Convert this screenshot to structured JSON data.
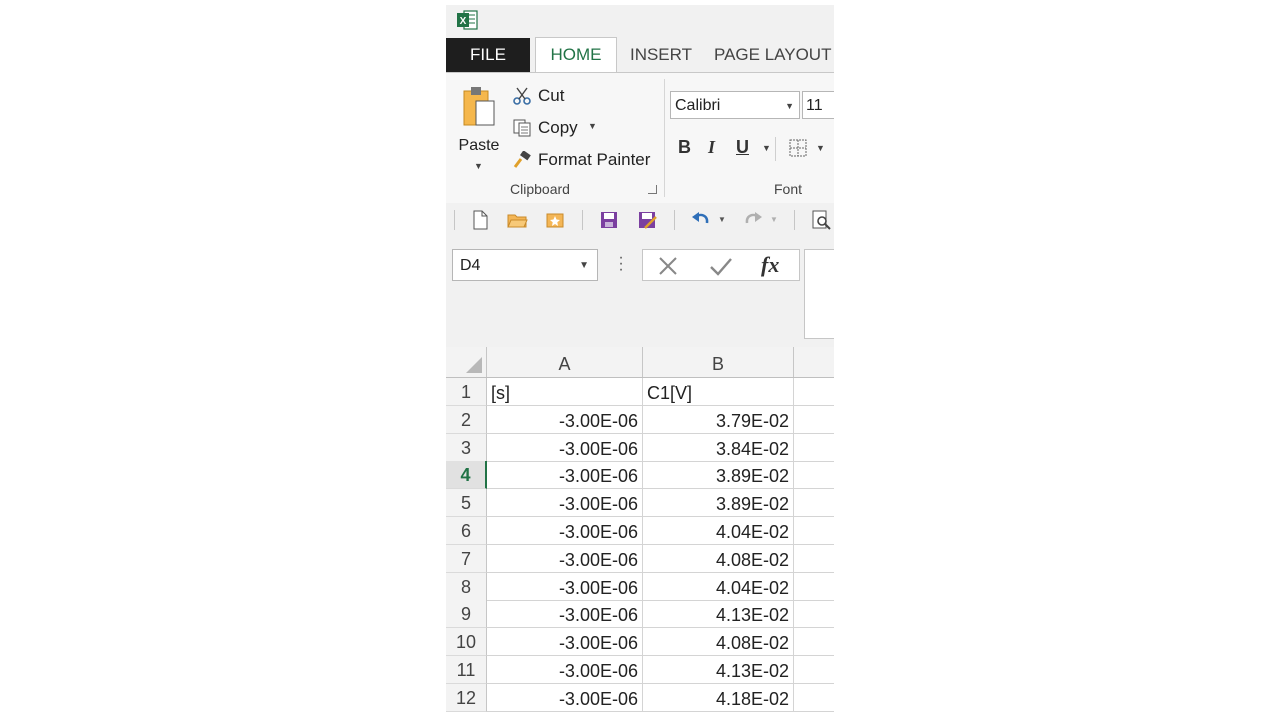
{
  "tabs": {
    "file": "FILE",
    "home": "HOME",
    "insert": "INSERT",
    "page_layout": "PAGE LAYOUT"
  },
  "clipboard": {
    "paste": "Paste",
    "cut": "Cut",
    "copy": "Copy",
    "format_painter": "Format Painter",
    "group_label": "Clipboard"
  },
  "font": {
    "name": "Calibri",
    "size": "11",
    "bold": "B",
    "italic": "I",
    "underline": "U",
    "group_label": "Font"
  },
  "formula_bar": {
    "name_box": "D4",
    "fx": "fx"
  },
  "grid": {
    "columns": [
      "A",
      "B"
    ],
    "active_row": "4",
    "rows": [
      {
        "num": "1",
        "a": "[s]",
        "b": "C1[V]"
      },
      {
        "num": "2",
        "a": "-3.00E-06",
        "b": "3.79E-02"
      },
      {
        "num": "3",
        "a": "-3.00E-06",
        "b": "3.84E-02"
      },
      {
        "num": "4",
        "a": "-3.00E-06",
        "b": "3.89E-02"
      },
      {
        "num": "5",
        "a": "-3.00E-06",
        "b": "3.89E-02"
      },
      {
        "num": "6",
        "a": "-3.00E-06",
        "b": "4.04E-02"
      },
      {
        "num": "7",
        "a": "-3.00E-06",
        "b": "4.08E-02"
      },
      {
        "num": "8",
        "a": "-3.00E-06",
        "b": "4.04E-02"
      },
      {
        "num": "9",
        "a": "-3.00E-06",
        "b": "4.13E-02"
      },
      {
        "num": "10",
        "a": "-3.00E-06",
        "b": "4.08E-02"
      },
      {
        "num": "11",
        "a": "-3.00E-06",
        "b": "4.13E-02"
      },
      {
        "num": "12",
        "a": "-3.00E-06",
        "b": "4.18E-02"
      }
    ]
  },
  "colors": {
    "excel_green": "#217346",
    "file_tab": "#1e1e1e",
    "paste_orange": "#f5b74c"
  },
  "icons": [
    "excel-logo-icon",
    "paste-icon",
    "scissors-icon",
    "copy-icon",
    "format-painter-icon",
    "new-document-icon",
    "open-folder-icon",
    "recent-icon",
    "save-icon",
    "save-as-icon",
    "undo-icon",
    "redo-icon",
    "print-preview-icon",
    "cancel-icon",
    "enter-icon",
    "insert-function-icon",
    "borders-icon"
  ]
}
